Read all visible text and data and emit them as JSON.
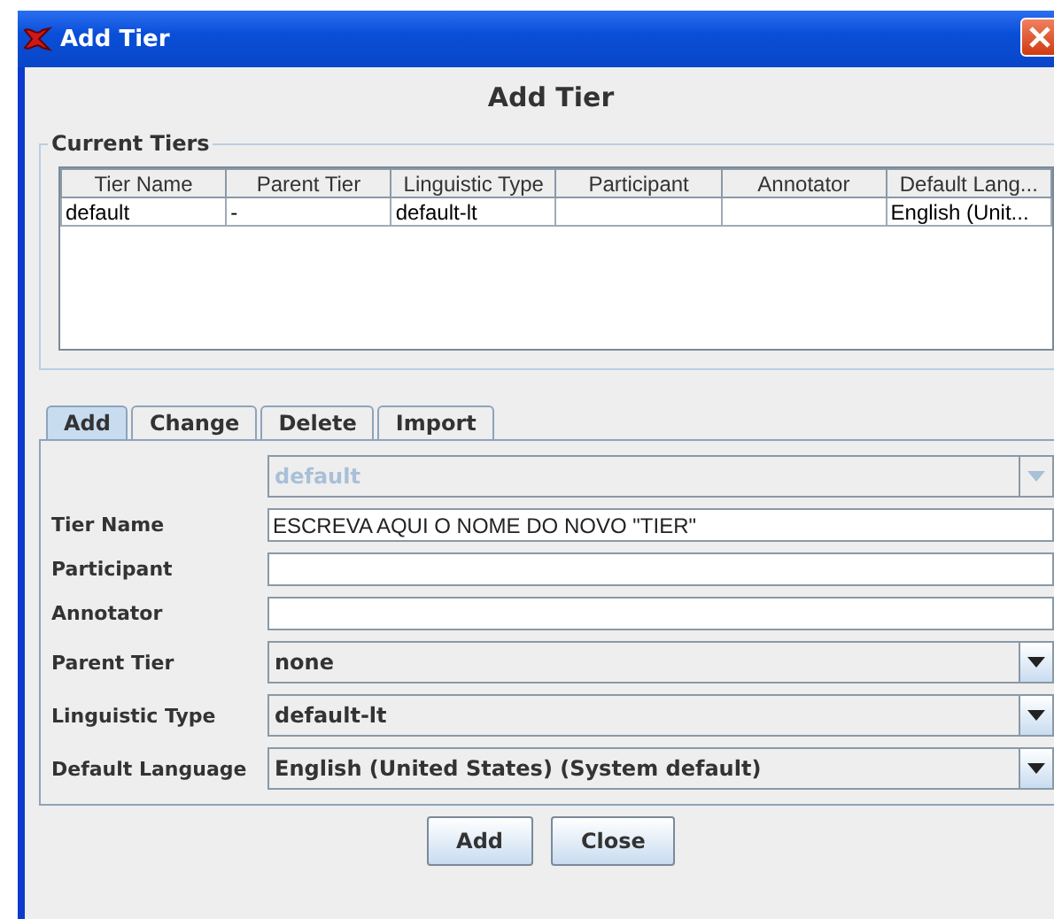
{
  "window": {
    "title": "Add Tier"
  },
  "heading": "Add Tier",
  "current_tiers": {
    "title": "Current Tiers",
    "columns": [
      "Tier Name",
      "Parent Tier",
      "Linguistic Type",
      "Participant",
      "Annotator",
      "Default Lang..."
    ],
    "rows": [
      [
        "default",
        "-",
        "default-lt",
        null,
        null,
        "English (Unit..."
      ]
    ]
  },
  "tabs": [
    {
      "label": "Add",
      "selected": true
    },
    {
      "label": "Change",
      "selected": false
    },
    {
      "label": "Delete",
      "selected": false
    },
    {
      "label": "Import",
      "selected": false
    }
  ],
  "form": [
    {
      "kind": "combo",
      "value": "default",
      "disabled": true
    },
    {
      "kind": "text",
      "label": "Tier Name",
      "value": "ESCREVA AQUI O NOME DO NOVO \"TIER\"",
      "disabled": false
    },
    {
      "kind": "text",
      "label": "Participant",
      "disabled": false
    },
    {
      "kind": "text",
      "label": "Annotator",
      "disabled": false
    },
    {
      "kind": "combo",
      "label": "Parent Tier",
      "value": "none",
      "disabled": false
    },
    {
      "kind": "combo",
      "label": "Linguistic Type",
      "value": "default-lt",
      "disabled": false
    },
    {
      "kind": "combo",
      "label": "Default Language",
      "value": "English (United States) (System default)",
      "disabled": false
    }
  ],
  "buttons": [
    "Add",
    "Close"
  ]
}
